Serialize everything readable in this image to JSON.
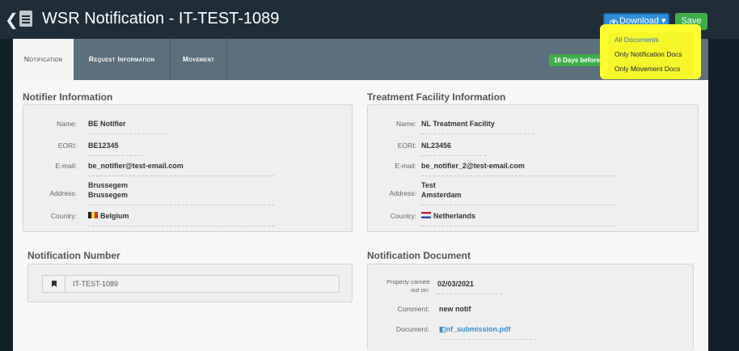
{
  "header": {
    "title": "WSR Notification - IT-TEST-1089",
    "download_label": "Download ▾",
    "save_label": "Save"
  },
  "tabs": [
    "Notification",
    "Request Information",
    "Movement"
  ],
  "badge": "16 Days before",
  "dropdown": [
    "All Documents",
    "Only Notification Docs",
    "Only Movement Docs"
  ],
  "notifier": {
    "title": "Notifier Information",
    "name_label": "Name:",
    "name": "BE Notifier",
    "eori_label": "EORI:",
    "eori": "BE12345",
    "email_label": "E-mail:",
    "email": "be_notifier@test-email.com",
    "address_label": "Address:",
    "address_1": "Brussegem",
    "address_2": "Brussegem",
    "country_label": "Country:",
    "country": "Belgium"
  },
  "facility": {
    "title": "Treatment Facility Information",
    "name_label": "Name:",
    "name": "NL Treatment Facility",
    "eori_label": "EORI:",
    "eori": "NL23456",
    "email_label": "E-mail:",
    "email": "be_notifier_2@test-email.com",
    "address_label": "Address:",
    "address_1": "Test",
    "address_2": "Amsterdam",
    "country_label": "Country:",
    "country": "Netherlands"
  },
  "notification_number": {
    "title": "Notification Number",
    "value": "IT-TEST-1089"
  },
  "notification_document": {
    "title": "Notification Document",
    "carried_label_1": "Properly carried",
    "carried_label_2": "out on:",
    "carried": "02/03/2021",
    "comment_label": "Comment:",
    "comment": "new notif",
    "document_label": "Document:",
    "document": "nf_submission.pdf"
  }
}
